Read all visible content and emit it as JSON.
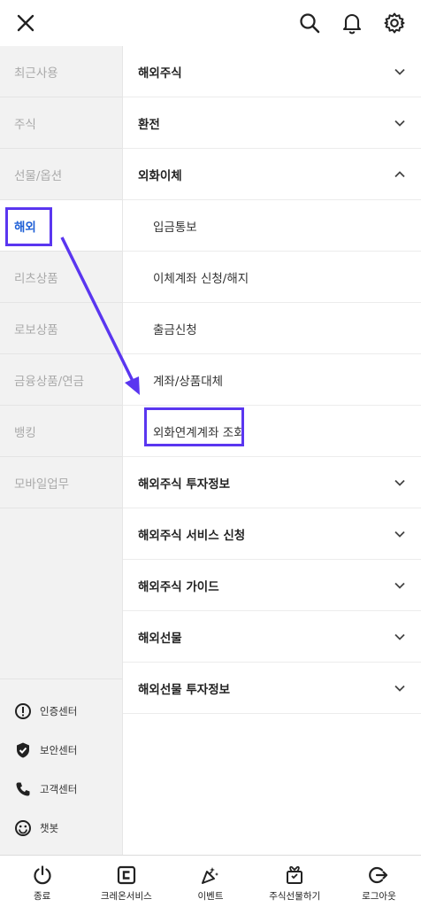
{
  "sidebar": {
    "items": [
      {
        "label": "최근사용"
      },
      {
        "label": "주식"
      },
      {
        "label": "선물/옵션"
      },
      {
        "label": "해외"
      },
      {
        "label": "리츠상품"
      },
      {
        "label": "로보상품"
      },
      {
        "label": "금융상품/연금"
      },
      {
        "label": "뱅킹"
      },
      {
        "label": "모바일업무"
      }
    ],
    "active": "해외",
    "utilities": [
      {
        "label": "인증센터",
        "icon": "info-icon"
      },
      {
        "label": "보안센터",
        "icon": "shield-check-icon"
      },
      {
        "label": "고객센터",
        "icon": "phone-icon"
      },
      {
        "label": "챗봇",
        "icon": "smiley-icon"
      }
    ]
  },
  "menu": {
    "sections": [
      {
        "label": "해외주식",
        "expanded": false
      },
      {
        "label": "환전",
        "expanded": false
      },
      {
        "label": "외화이체",
        "expanded": true
      }
    ],
    "subitems": [
      {
        "label": "입금통보"
      },
      {
        "label": "이체계좌 신청/해지"
      },
      {
        "label": "출금신청"
      },
      {
        "label": "계좌/상품대체"
      },
      {
        "label": "외화연계계좌 조회"
      }
    ],
    "more_sections": [
      {
        "label": "해외주식 투자정보"
      },
      {
        "label": "해외주식 서비스 신청"
      },
      {
        "label": "해외주식 가이드"
      },
      {
        "label": "해외선물"
      },
      {
        "label": "해외선물 투자정보"
      }
    ]
  },
  "bottom_nav": [
    {
      "label": "종료",
      "icon": "power-icon"
    },
    {
      "label": "크레온서비스",
      "icon": "creon-logo-icon"
    },
    {
      "label": "이벤트",
      "icon": "party-popper-icon"
    },
    {
      "label": "주식선물하기",
      "icon": "gift-box-icon"
    },
    {
      "label": "로그아웃",
      "icon": "logout-icon"
    }
  ],
  "colors": {
    "accent": "#5a36f0",
    "active_text": "#1e5fd6",
    "sidebar_bg": "#f2f2f2"
  }
}
